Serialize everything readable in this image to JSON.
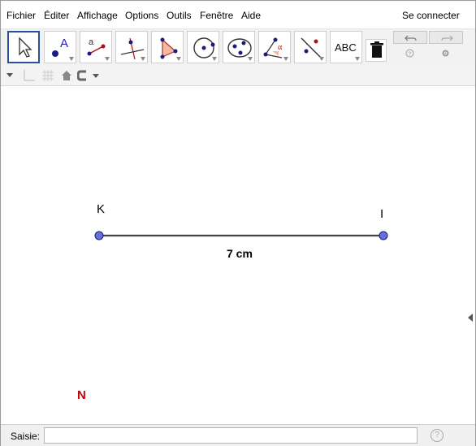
{
  "menu": {
    "items": [
      "Fichier",
      "Éditer",
      "Affichage",
      "Options",
      "Outils",
      "Fenêtre",
      "Aide"
    ],
    "signin": "Se connecter"
  },
  "toolbar": {
    "tools": [
      {
        "name": "move-tool",
        "icon": "arrow-cursor-icon"
      },
      {
        "name": "point-tool",
        "icon": "point-a-icon",
        "text": "A"
      },
      {
        "name": "line-tool",
        "icon": "segment-a-icon",
        "text": "a"
      },
      {
        "name": "perpendicular-tool",
        "icon": "perpendicular-line-icon"
      },
      {
        "name": "polygon-tool",
        "icon": "triangle-icon"
      },
      {
        "name": "circle-tool",
        "icon": "circle-center-icon"
      },
      {
        "name": "conic-tool",
        "icon": "ellipse-icon"
      },
      {
        "name": "angle-tool",
        "icon": "angle-alpha-icon",
        "text": "α"
      },
      {
        "name": "reflect-tool",
        "icon": "reflect-line-icon"
      },
      {
        "name": "text-tool",
        "icon": "text-abc-icon",
        "text": "ABC"
      }
    ],
    "delete_icon": "trash-icon",
    "undo_icon": "undo-icon",
    "redo_icon": "redo-icon",
    "help_icon": "help-icon",
    "settings_icon": "gear-icon"
  },
  "stylebar": {
    "icons": [
      "menu-toggle-icon",
      "axes-icon",
      "grid-icon",
      "home-icon",
      "point-capture-icon"
    ]
  },
  "canvas": {
    "points": [
      {
        "id": "K",
        "label": "K",
        "color": "#000000"
      },
      {
        "id": "I",
        "label": "I",
        "color": "#000000"
      },
      {
        "id": "N",
        "label": "N",
        "color": "#cc0000"
      }
    ],
    "segment_label": "7 cm",
    "point_fill": "#6670dd",
    "point_stroke": "#1a1a80"
  },
  "input_bar": {
    "label": "Saisie:",
    "value": "",
    "placeholder": ""
  },
  "colors": {
    "selected_border": "#2a4f9a",
    "toolbar_bg": "#f2f2f2"
  }
}
